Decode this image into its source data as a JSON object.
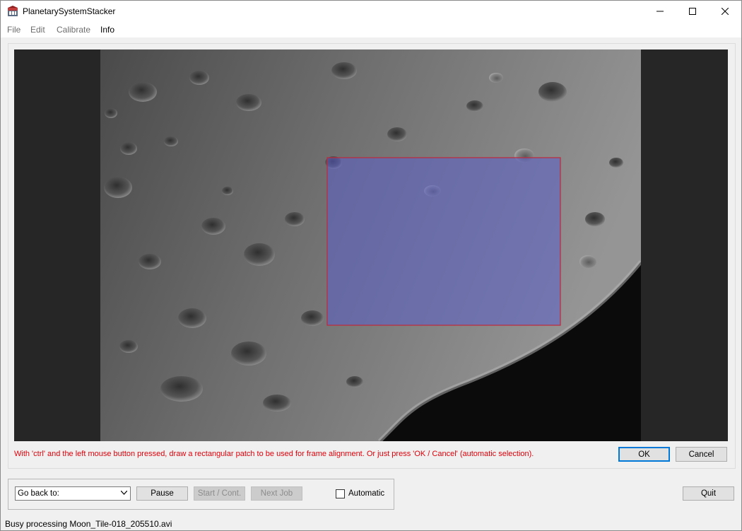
{
  "window": {
    "title": "PlanetarySystemStacker",
    "minimize_icon": "minimize-icon",
    "maximize_icon": "maximize-icon",
    "close_icon": "close-icon"
  },
  "menu": {
    "items": [
      {
        "label": "File",
        "enabled": false
      },
      {
        "label": "Edit",
        "enabled": false
      },
      {
        "label": "Calibrate",
        "enabled": false
      },
      {
        "label": "Info",
        "enabled": true
      }
    ]
  },
  "viewer": {
    "image_subject": "moon-terminator-craters",
    "selection_fill": "#5a5fc8",
    "selection_border": "#c0283a"
  },
  "instruction": "With 'ctrl' and the left mouse button pressed, draw a rectangular patch to be used for frame alignment. Or just press 'OK / Cancel' (automatic selection).",
  "dialog_buttons": {
    "ok": "OK",
    "cancel": "Cancel"
  },
  "controls": {
    "go_back_value": "Go back to:",
    "pause": "Pause",
    "start_cont": "Start / Cont.",
    "next_job": "Next Job",
    "automatic_label": "Automatic",
    "automatic_checked": false,
    "quit": "Quit"
  },
  "status_bar": "Busy processing Moon_Tile-018_205510.avi"
}
